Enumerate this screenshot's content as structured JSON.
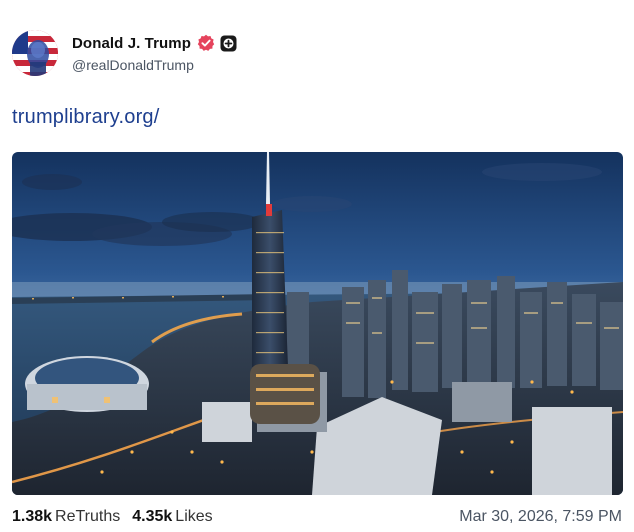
{
  "post": {
    "author": {
      "display_name": "Donald J. Trump",
      "handle": "@realDonaldTrump",
      "avatar_icon": "avatar-image",
      "verified_icon": "verified-badge-icon",
      "verified_color": "#e5435c",
      "plus_icon": "plus-badge-icon"
    },
    "link_text": "trumplibrary.org/",
    "link_color": "#1e3f8f",
    "media": {
      "kind": "photo",
      "description_icon": "city-skyline-photo"
    },
    "stats": {
      "retruths_count": "1.38k",
      "retruths_label": "ReTruths",
      "likes_count": "4.35k",
      "likes_label": "Likes"
    },
    "timestamp": "Mar 30, 2026, 7:59 PM"
  }
}
